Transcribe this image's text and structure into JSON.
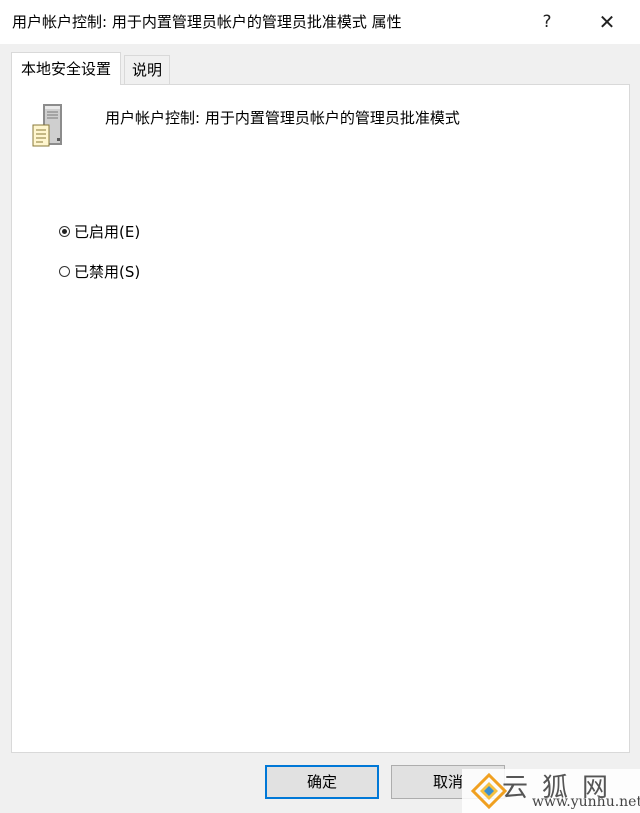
{
  "window": {
    "title": "用户帐户控制: 用于内置管理员帐户的管理员批准模式 属性",
    "help_label": "?",
    "close_label": "✕"
  },
  "tabs": [
    {
      "label": "本地安全设置",
      "active": true
    },
    {
      "label": "说明",
      "active": false
    }
  ],
  "policy": {
    "icon": "server-policy-icon",
    "name": "用户帐户控制: 用于内置管理员帐户的管理员批准模式"
  },
  "options": [
    {
      "label": "已启用(E)",
      "selected": true
    },
    {
      "label": "已禁用(S)",
      "selected": false
    }
  ],
  "buttons": {
    "ok_label": "确定",
    "cancel_label": "取消"
  },
  "watermark": {
    "name": "云狐网",
    "url": "www.yunhu.net"
  },
  "colors": {
    "accent": "#0078d7",
    "panel_bg": "#ffffff",
    "window_bg": "#f0f0f0"
  }
}
